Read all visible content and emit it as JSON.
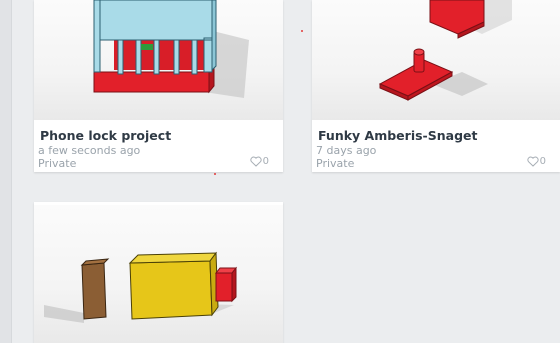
{
  "projects": [
    {
      "title": "Phone lock project",
      "edited": "a few seconds ago",
      "visibility": "Private",
      "likes": "0",
      "icon": "heart-icon"
    },
    {
      "title": "Funky Amberis-Snaget",
      "edited": "7 days ago",
      "visibility": "Private",
      "likes": "0",
      "icon": "heart-icon"
    },
    {
      "title": "",
      "edited": "",
      "visibility": "",
      "likes": ""
    }
  ],
  "colors": {
    "page_bg": "#ebedef",
    "card_bg": "#ffffff",
    "title": "#2f3a45",
    "meta": "#9aa3ab",
    "shape_red": "#e2202a",
    "shape_blue": "#a9dbe8",
    "shape_yellow": "#e6c619",
    "shape_brown": "#8b5e34"
  }
}
